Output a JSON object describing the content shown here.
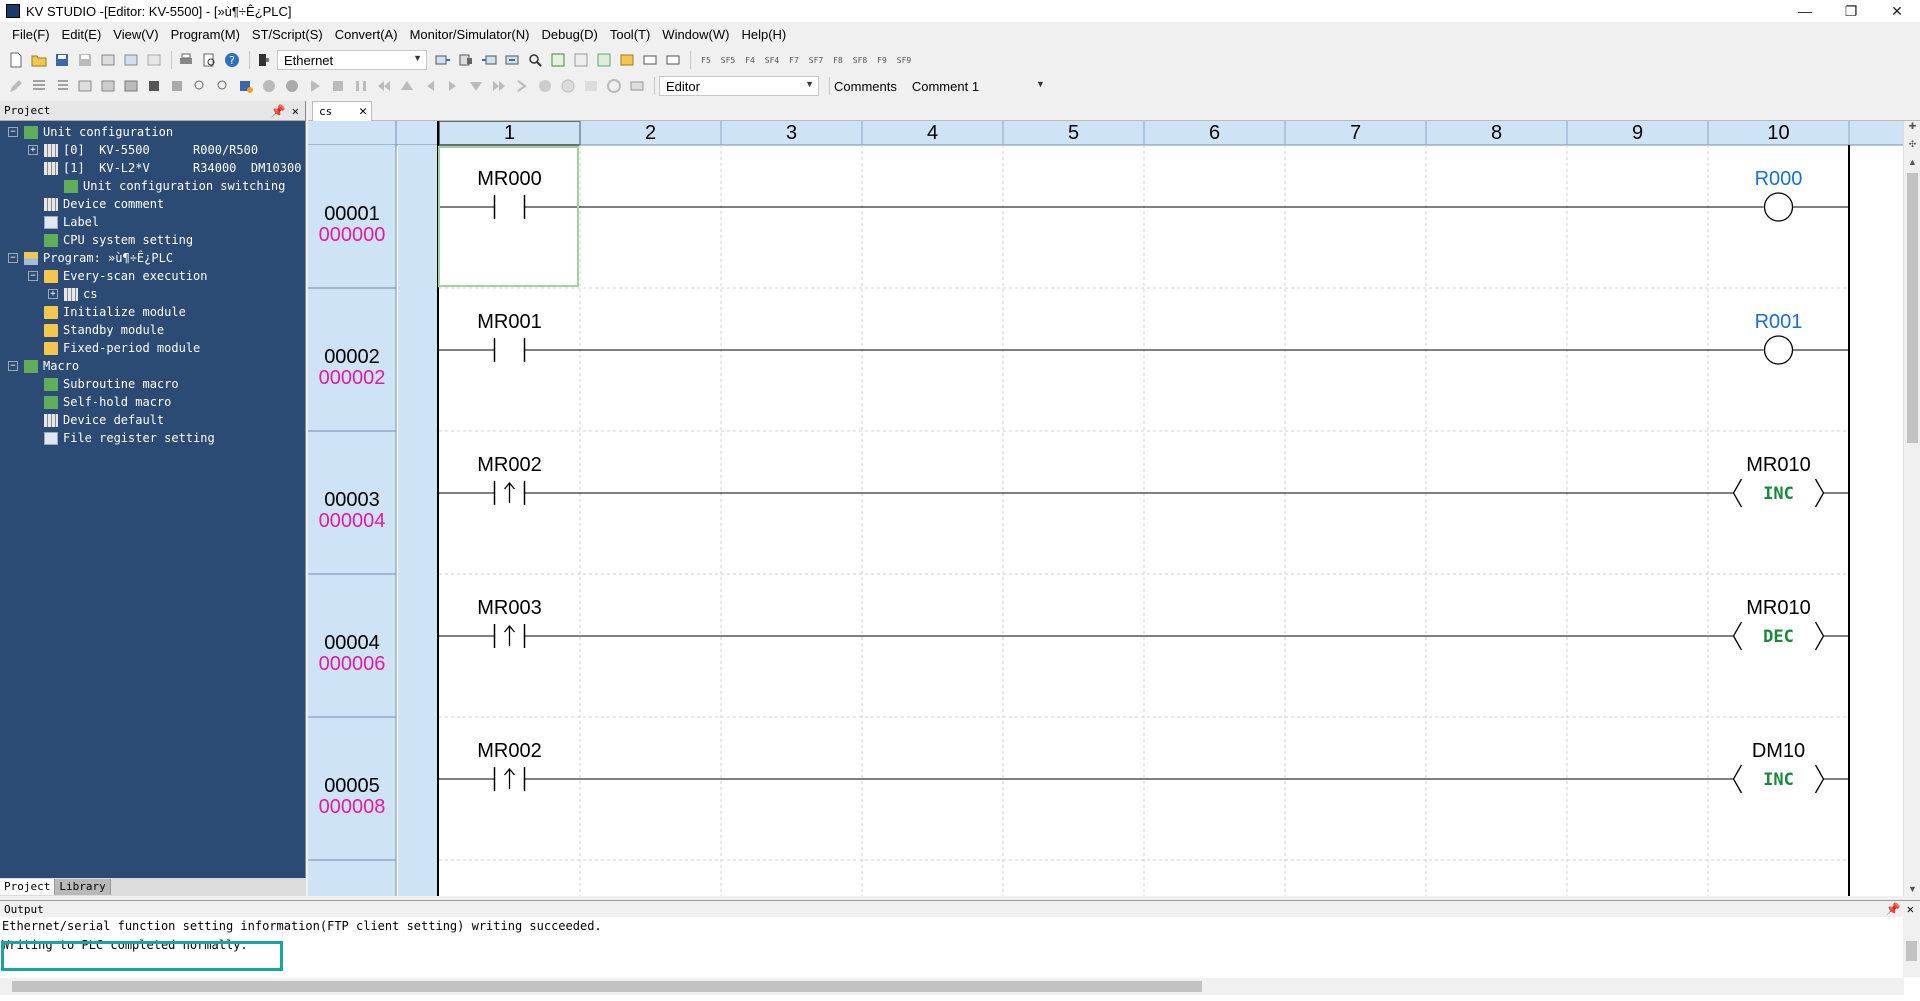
{
  "window": {
    "title": "KV STUDIO -[Editor: KV-5500] - [»ù¶÷Ê¿PLC]",
    "minimize": "—",
    "restore": "❐",
    "close": "✕"
  },
  "menu": [
    "File(F)",
    "Edit(E)",
    "View(V)",
    "Program(M)",
    "ST/Script(S)",
    "Convert(A)",
    "Monitor/Simulator(N)",
    "Debug(D)",
    "Tool(T)",
    "Window(W)",
    "Help(H)"
  ],
  "toolbar": {
    "connection": "Ethernet",
    "mode": "Editor",
    "comments_label": "Comments",
    "comment_select": "Comment 1",
    "fkeys": [
      "F5",
      "SF5",
      "F4",
      "SF4",
      "F7",
      "SF7",
      "F8",
      "SF8",
      "F9",
      "SF9"
    ]
  },
  "project_panel": {
    "title": "Project",
    "tree": [
      {
        "label": "Unit configuration",
        "indent": 0,
        "exp": "-",
        "icon": "green"
      },
      {
        "label": "[0]  KV-5500      R000/R500",
        "indent": 1,
        "exp": "+",
        "icon": "grid"
      },
      {
        "label": "[1]  KV-L2*V      R34000  DM10300",
        "indent": 1,
        "exp": "",
        "icon": "grid"
      },
      {
        "label": "Unit configuration switching",
        "indent": 2,
        "exp": "",
        "icon": "green"
      },
      {
        "label": "Device comment",
        "indent": 1,
        "exp": "",
        "icon": "grid"
      },
      {
        "label": "Label",
        "indent": 1,
        "exp": "",
        "icon": "doc"
      },
      {
        "label": "CPU system setting",
        "indent": 1,
        "exp": "",
        "icon": "green"
      },
      {
        "label": "Program: »ù¶÷Ê¿PLC",
        "indent": 0,
        "exp": "-",
        "icon": "prog"
      },
      {
        "label": "Every-scan execution",
        "indent": 1,
        "exp": "-",
        "icon": "folder"
      },
      {
        "label": "cs",
        "indent": 2,
        "exp": "+",
        "icon": "grid"
      },
      {
        "label": "Initialize module",
        "indent": 1,
        "exp": "",
        "icon": "folder"
      },
      {
        "label": "Standby module",
        "indent": 1,
        "exp": "",
        "icon": "folder"
      },
      {
        "label": "Fixed-period module",
        "indent": 1,
        "exp": "",
        "icon": "folder"
      },
      {
        "label": "Macro",
        "indent": 0,
        "exp": "-",
        "icon": "green"
      },
      {
        "label": "Subroutine macro",
        "indent": 1,
        "exp": "",
        "icon": "green"
      },
      {
        "label": "Self-hold macro",
        "indent": 1,
        "exp": "",
        "icon": "green"
      },
      {
        "label": "Device default",
        "indent": 1,
        "exp": "",
        "icon": "grid"
      },
      {
        "label": "File register setting",
        "indent": 1,
        "exp": "",
        "icon": "doc"
      }
    ],
    "tabs": [
      "Project",
      "Library"
    ]
  },
  "editor": {
    "tab_label": "cs",
    "columns": [
      "1",
      "2",
      "3",
      "4",
      "5",
      "6",
      "7",
      "8",
      "9",
      "10"
    ],
    "rungs": [
      {
        "line": "00001",
        "step": "000000",
        "contact": "MR000",
        "contact_type": "no",
        "out_device": "R000",
        "out_type": "coil",
        "out_instr": ""
      },
      {
        "line": "00002",
        "step": "000002",
        "contact": "MR001",
        "contact_type": "no",
        "out_device": "R001",
        "out_type": "coil",
        "out_instr": ""
      },
      {
        "line": "00003",
        "step": "000004",
        "contact": "MR002",
        "contact_type": "rise",
        "out_device": "MR010",
        "out_type": "func",
        "out_instr": "INC"
      },
      {
        "line": "00004",
        "step": "000006",
        "contact": "MR003",
        "contact_type": "rise",
        "out_device": "MR010",
        "out_type": "func",
        "out_instr": "DEC"
      },
      {
        "line": "00005",
        "step": "000008",
        "contact": "MR002",
        "contact_type": "rise",
        "out_device": "DM10",
        "out_type": "func",
        "out_instr": "INC"
      }
    ]
  },
  "output_panel": {
    "title": "Output",
    "lines": [
      "Ethernet/serial function setting information(FTP client setting) writing succeeded.",
      "Writing to PLC completed normally."
    ]
  },
  "colors": {
    "tree_bg": "#2b4a74",
    "header_bg": "#cfe3f7",
    "step_color": "#e21ba6",
    "coil_device_color": "#1a6fd3",
    "instr_color": "#1a8a3a",
    "highlight_border": "#1aa5a5"
  }
}
